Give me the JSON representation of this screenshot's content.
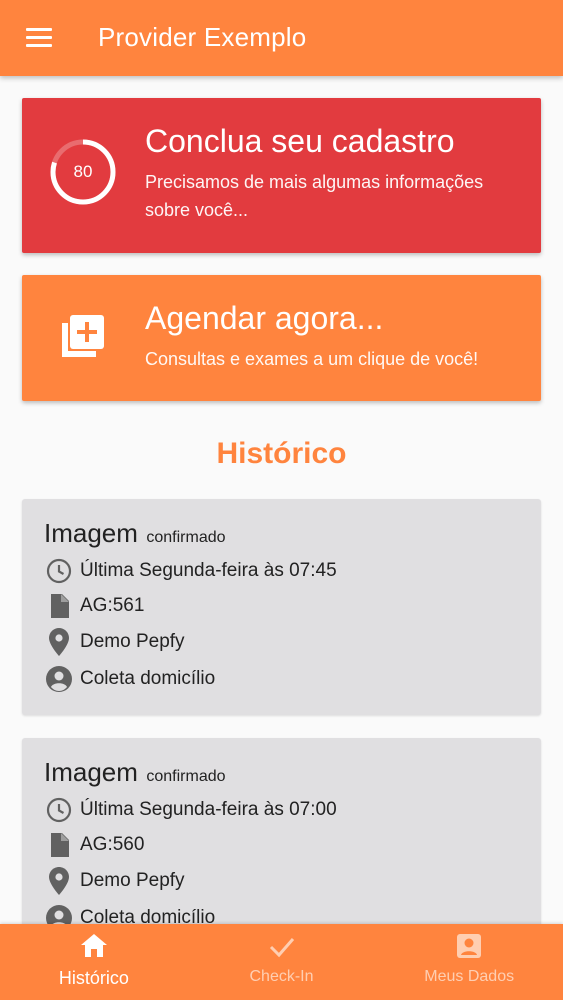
{
  "app_bar": {
    "title": "Provider Exemplo",
    "menu_icon": "menu-icon"
  },
  "profile_card": {
    "title": "Conclua seu cadastro",
    "subtitle": "Precisamos de mais algumas informações sobre você...",
    "progress_label": "80",
    "progress_fraction": 0.8,
    "color": "#e23b3f"
  },
  "schedule_card": {
    "title": "Agendar agora...",
    "subtitle": "Consultas e exames a um clique de você!",
    "icon": "add-to-queue-icon",
    "color": "#ff843e"
  },
  "history": {
    "title": "Histórico",
    "items": [
      {
        "type": "Imagem",
        "status": "confirmado",
        "datetime": "Última Segunda-feira às 07:45",
        "code": "AG:561",
        "place": "Demo Pepfy",
        "service": "Coleta domicílio"
      },
      {
        "type": "Imagem",
        "status": "confirmado",
        "datetime": "Última Segunda-feira às 07:00",
        "code": "AG:560",
        "place": "Demo Pepfy",
        "service": "Coleta domicílio"
      }
    ]
  },
  "bottom_nav": {
    "items": [
      {
        "label": "Histórico",
        "icon": "home-icon",
        "active": true
      },
      {
        "label": "Check-In",
        "icon": "check-icon",
        "active": false
      },
      {
        "label": "Meus Dados",
        "icon": "account-box-icon",
        "active": false
      }
    ]
  },
  "colors": {
    "accent": "#ff843e",
    "alert": "#e23b3f",
    "history_card_bg": "#e0dfe1"
  }
}
